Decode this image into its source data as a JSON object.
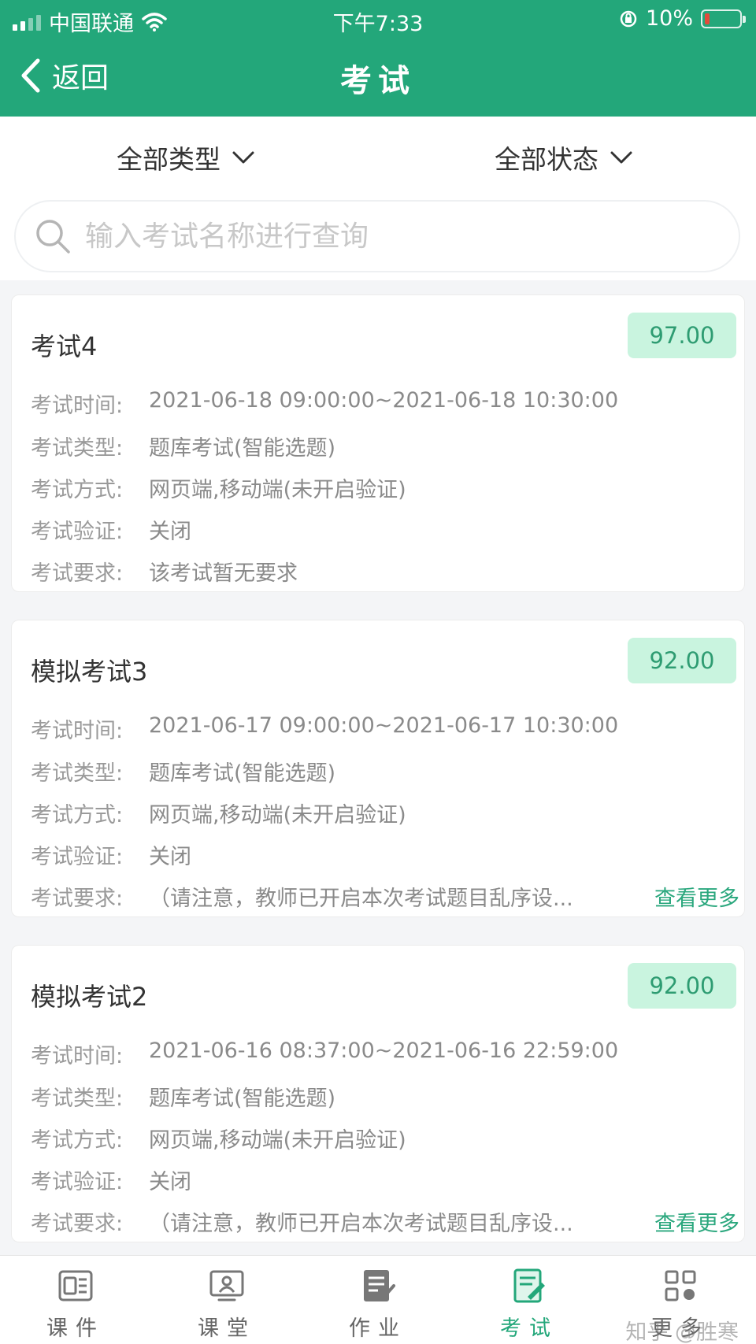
{
  "status_bar": {
    "carrier": "中国联通",
    "time": "下午7:33",
    "battery": "10%"
  },
  "nav": {
    "back_label": "返回",
    "title": "考试"
  },
  "filters": {
    "type_label": "全部类型",
    "status_label": "全部状态"
  },
  "search": {
    "placeholder": "输入考试名称进行查询"
  },
  "labels": {
    "time": "考试时间:",
    "type": "考试类型:",
    "mode": "考试方式:",
    "verify": "考试验证:",
    "require": "考试要求:",
    "more": "查看更多"
  },
  "exams": [
    {
      "title": "考试4",
      "score": "97.00",
      "time": "2021-06-18 09:00:00~2021-06-18 10:30:00",
      "type": "题库考试(智能选题)",
      "mode": "网页端,移动端(未开启验证)",
      "verify": "关闭",
      "require": "该考试暂无要求"
    },
    {
      "title": "模拟考试3",
      "score": "92.00",
      "time": "2021-06-17 09:00:00~2021-06-17 10:30:00",
      "type": "题库考试(智能选题)",
      "mode": "网页端,移动端(未开启验证)",
      "verify": "关闭",
      "require": "（请注意，教师已开启本次考试题目乱序设..."
    },
    {
      "title": "模拟考试2",
      "score": "92.00",
      "time": "2021-06-16 08:37:00~2021-06-16 22:59:00",
      "type": "题库考试(智能选题)",
      "mode": "网页端,移动端(未开启验证)",
      "verify": "关闭",
      "require": "（请注意，教师已开启本次考试题目乱序设..."
    }
  ],
  "tabs": [
    {
      "label": "课件",
      "icon": "courseware-icon"
    },
    {
      "label": "课堂",
      "icon": "classroom-icon"
    },
    {
      "label": "作业",
      "icon": "homework-icon"
    },
    {
      "label": "考试",
      "icon": "exam-icon",
      "active": true
    },
    {
      "label": "更多",
      "icon": "more-grid-icon"
    }
  ],
  "watermark": "知乎 @胜寒",
  "colors": {
    "brand": "#23a77a",
    "score_bg": "#c9f4df",
    "score_text": "#2e9c72",
    "link": "#2aa77d"
  }
}
